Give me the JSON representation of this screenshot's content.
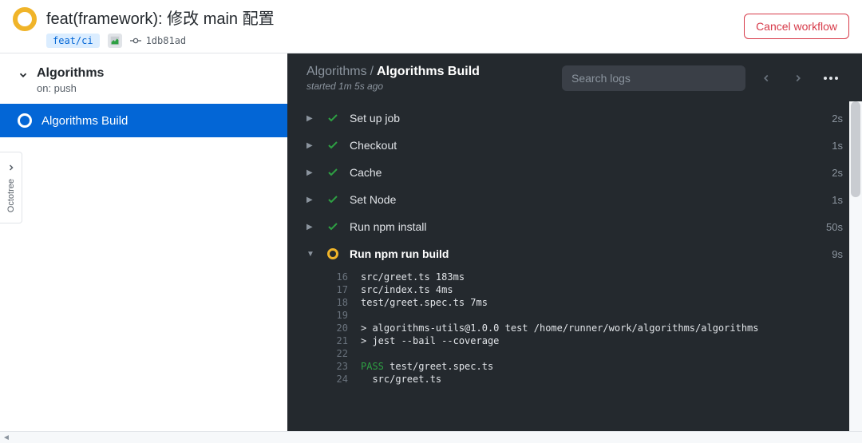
{
  "header": {
    "title": "feat(framework): 修改 main 配置",
    "branch": "feat/ci",
    "commit_hash": "1db81ad",
    "cancel_label": "Cancel workflow"
  },
  "sidebar": {
    "workflow_name": "Algorithms",
    "trigger_text": "on: push",
    "job_name": "Algorithms Build"
  },
  "log_header": {
    "breadcrumb_parent": "Algorithms",
    "breadcrumb_current": "Algorithms Build",
    "subtitle": "started 1m 5s ago",
    "search_placeholder": "Search logs"
  },
  "steps": [
    {
      "name": "Set up job",
      "status": "success",
      "expanded": false,
      "duration": "2s"
    },
    {
      "name": "Checkout",
      "status": "success",
      "expanded": false,
      "duration": "1s"
    },
    {
      "name": "Cache",
      "status": "success",
      "expanded": false,
      "duration": "2s"
    },
    {
      "name": "Set Node",
      "status": "success",
      "expanded": false,
      "duration": "1s"
    },
    {
      "name": "Run npm install",
      "status": "success",
      "expanded": false,
      "duration": "50s"
    },
    {
      "name": "Run npm run build",
      "status": "running",
      "expanded": true,
      "duration": "9s"
    }
  ],
  "log_lines": [
    {
      "n": "16",
      "t": "src/greet.ts 183ms"
    },
    {
      "n": "17",
      "t": "src/index.ts 4ms"
    },
    {
      "n": "18",
      "t": "test/greet.spec.ts 7ms"
    },
    {
      "n": "19",
      "t": ""
    },
    {
      "n": "20",
      "t": "> algorithms-utils@1.0.0 test /home/runner/work/algorithms/algorithms"
    },
    {
      "n": "21",
      "t": "> jest --bail --coverage"
    },
    {
      "n": "22",
      "t": ""
    },
    {
      "n": "23",
      "t": "PASS test/greet.spec.ts",
      "pass": true
    },
    {
      "n": "24",
      "t": "  src/greet.ts"
    }
  ],
  "octotree": {
    "label": "Octotree"
  }
}
